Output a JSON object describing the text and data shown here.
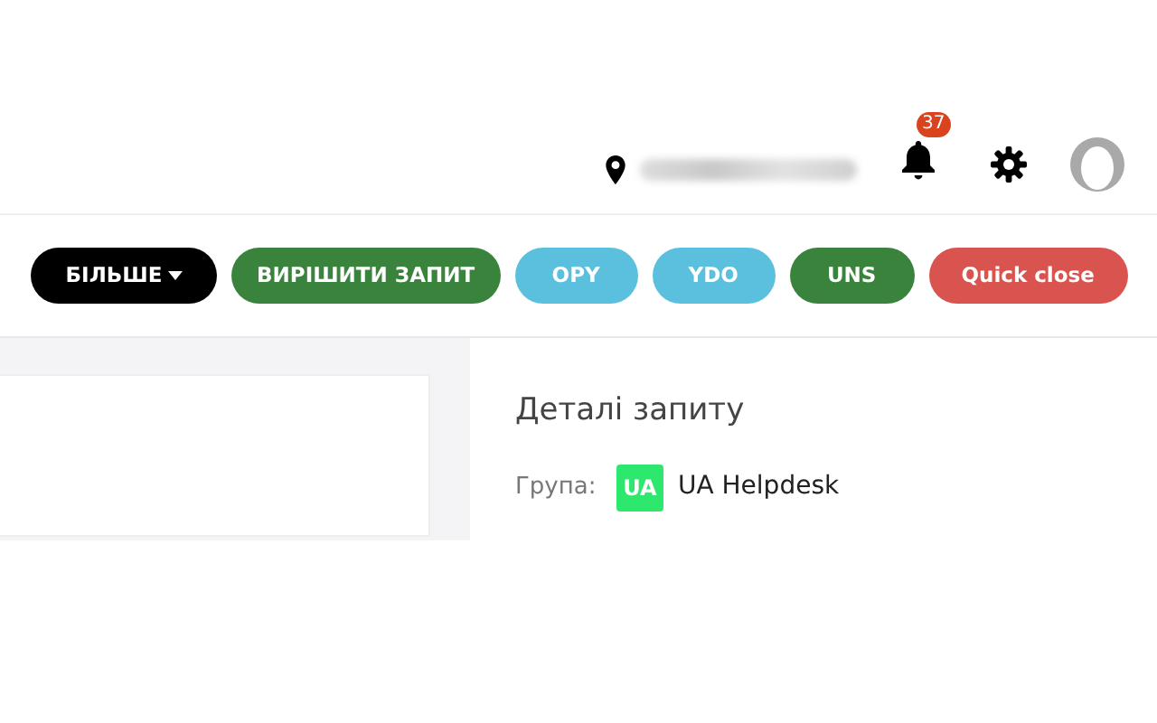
{
  "header": {
    "notifications": {
      "count": "37"
    }
  },
  "actions": [
    {
      "label": "БІЛЬШЕ",
      "kind": "dark",
      "dropdown": true
    },
    {
      "label": "ВИРІШИТИ ЗАПИТ",
      "kind": "success",
      "dropdown": false
    },
    {
      "label": "OPY",
      "kind": "info",
      "dropdown": false
    },
    {
      "label": "YDO",
      "kind": "info",
      "dropdown": false
    },
    {
      "label": "UNS",
      "kind": "success",
      "dropdown": false
    },
    {
      "label": "Quick close",
      "kind": "danger",
      "dropdown": false
    }
  ],
  "details": {
    "title": "Деталі запиту",
    "group_label": "Група:",
    "group_badge": "UA",
    "group_name": "UA Helpdesk"
  }
}
